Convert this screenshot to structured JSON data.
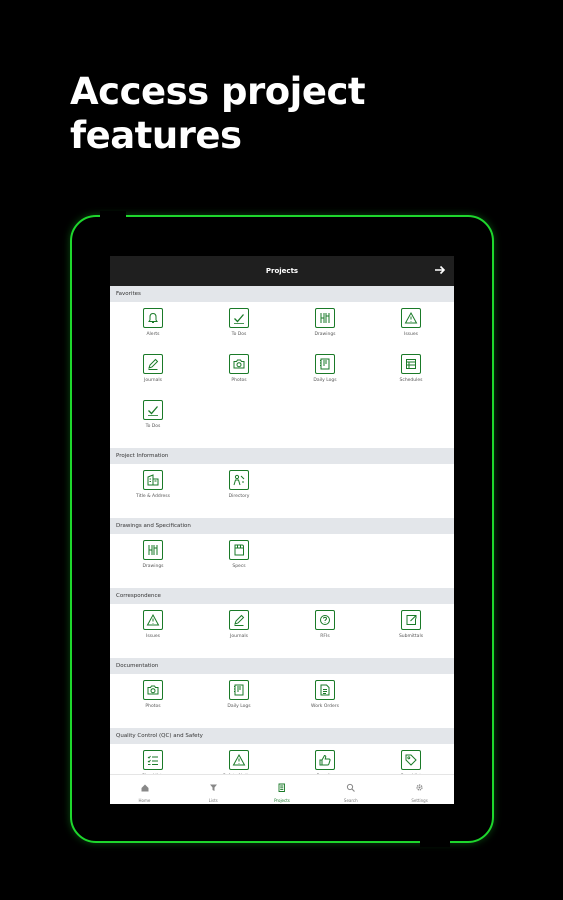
{
  "headline": {
    "line1": "Access project",
    "line2": "features"
  },
  "topbar": {
    "title": "Projects"
  },
  "sections": [
    {
      "title": "Favorites",
      "items": [
        {
          "label": "Alerts",
          "icon": "bell-icon"
        },
        {
          "label": "To Dos",
          "icon": "checkmark-icon"
        },
        {
          "label": "Drawings",
          "icon": "drawings-icon"
        },
        {
          "label": "Issues",
          "icon": "warning-icon"
        },
        {
          "label": "Journals",
          "icon": "pencil-icon"
        },
        {
          "label": "Photos",
          "icon": "camera-icon"
        },
        {
          "label": "Daily Logs",
          "icon": "daily-log-icon"
        },
        {
          "label": "Schedules",
          "icon": "schedule-icon"
        },
        {
          "label": "To Dos",
          "icon": "checkmark-icon"
        }
      ]
    },
    {
      "title": "Project Information",
      "items": [
        {
          "label": "Title & Address",
          "icon": "building-icon"
        },
        {
          "label": "Directory",
          "icon": "people-icon"
        }
      ]
    },
    {
      "title": "Drawings and Specification",
      "items": [
        {
          "label": "Drawings",
          "icon": "drawings-icon"
        },
        {
          "label": "Specs",
          "icon": "spec-book-icon"
        }
      ]
    },
    {
      "title": "Correspondence",
      "items": [
        {
          "label": "Issues",
          "icon": "warning-icon"
        },
        {
          "label": "Journals",
          "icon": "pencil-icon"
        },
        {
          "label": "RFIs",
          "icon": "question-icon"
        },
        {
          "label": "Submittals",
          "icon": "submittal-icon"
        }
      ]
    },
    {
      "title": "Documentation",
      "items": [
        {
          "label": "Photos",
          "icon": "camera-icon"
        },
        {
          "label": "Daily Logs",
          "icon": "daily-log-icon"
        },
        {
          "label": "Work Orders",
          "icon": "document-icon"
        }
      ]
    },
    {
      "title": "Quality Control (QC) and Safety",
      "items": [
        {
          "label": "Checklists",
          "icon": "checklist-icon"
        },
        {
          "label": "Safety Notices",
          "icon": "warning-icon"
        },
        {
          "label": "Permits",
          "icon": "thumbs-up-icon"
        },
        {
          "label": "Punchlist",
          "icon": "tag-icon"
        }
      ]
    }
  ],
  "bottomnav": [
    {
      "label": "Home",
      "icon": "home-icon",
      "active": false
    },
    {
      "label": "Lists",
      "icon": "filter-icon",
      "active": false
    },
    {
      "label": "Projects",
      "icon": "projects-icon",
      "active": true
    },
    {
      "label": "Search",
      "icon": "search-icon",
      "active": false
    },
    {
      "label": "Settings",
      "icon": "gear-icon",
      "active": false
    }
  ],
  "colors": {
    "accent": "#1ed72d",
    "icon_green": "#1a7a28",
    "background": "#000000"
  }
}
